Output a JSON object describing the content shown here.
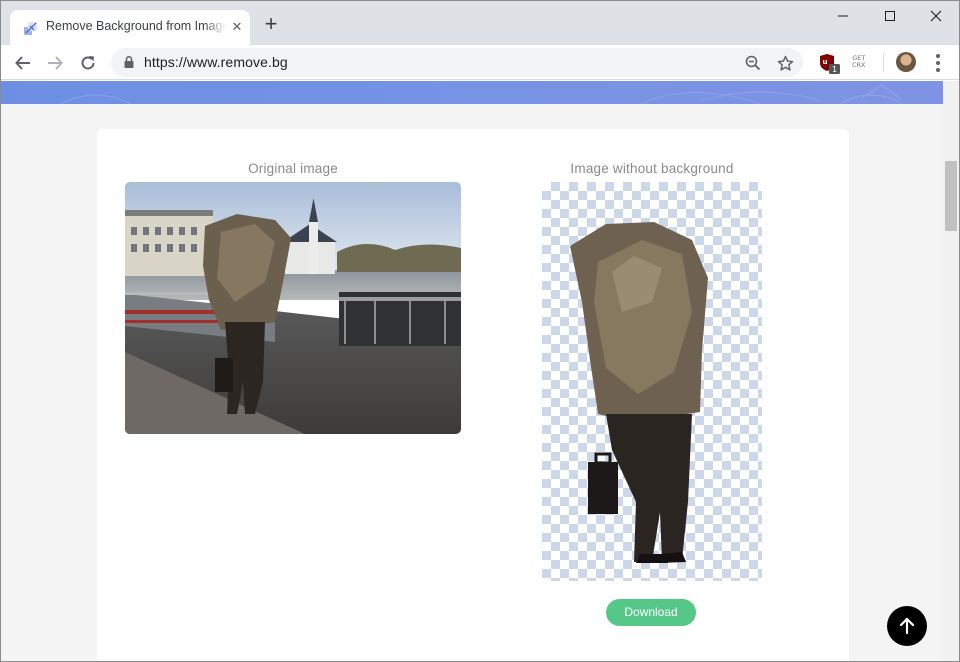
{
  "tab": {
    "title": "Remove Background from Image",
    "close": "✕",
    "new_tab": "+"
  },
  "window_controls": {
    "minimize": "minimize",
    "maximize": "maximize",
    "close": "close"
  },
  "address_bar": {
    "url": "https://www.remove.bg"
  },
  "extensions": {
    "ublock_badge": "1",
    "crx_line1": "GET",
    "crx_line2": "CRX"
  },
  "main": {
    "original_caption": "Original image",
    "result_caption": "Image without background",
    "download_label": "Download"
  },
  "colors": {
    "banner": "#7693e6",
    "download": "#55c789",
    "checker": "#cdd7ea"
  }
}
